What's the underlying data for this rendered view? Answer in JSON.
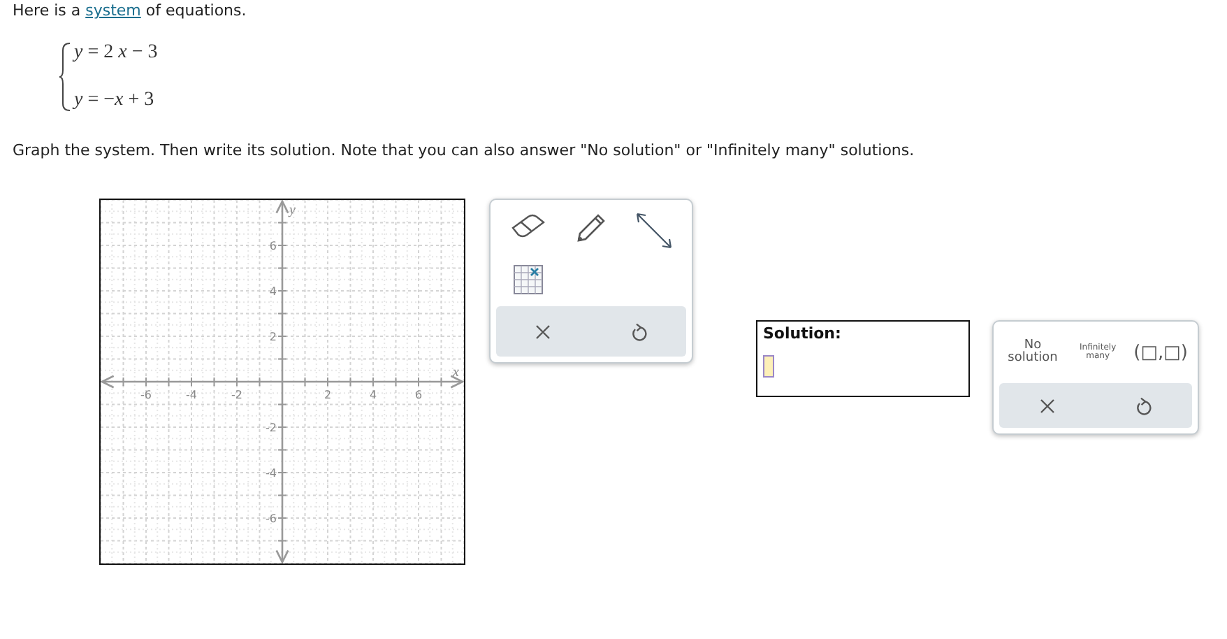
{
  "intro": {
    "before": "Here is a ",
    "link": "system",
    "after": " of equations."
  },
  "equations": [
    "*y* = 2 *x* − 3",
    "*y* = −*x* + 3"
  ],
  "instruction": "Graph the system. Then write its solution. Note that you can also answer \"No solution\" or \"Infinitely many\" solutions.",
  "graph": {
    "chart_data": {
      "type": "scatter",
      "grid": true,
      "xlabel": "x",
      "ylabel": "y",
      "xlim": [
        -8,
        8
      ],
      "ylim": [
        -8,
        8
      ],
      "xticks": [
        -6,
        -4,
        -2,
        2,
        4,
        6
      ],
      "yticks": [
        -6,
        -4,
        -2,
        2,
        4,
        6
      ]
    }
  },
  "solution": {
    "label": "Solution:"
  },
  "answer_buttons": [
    {
      "kind": "none",
      "label": "No solution"
    },
    {
      "kind": "infinite",
      "label": "Infinitely many"
    },
    {
      "kind": "pair",
      "label": "(□,□)"
    }
  ]
}
